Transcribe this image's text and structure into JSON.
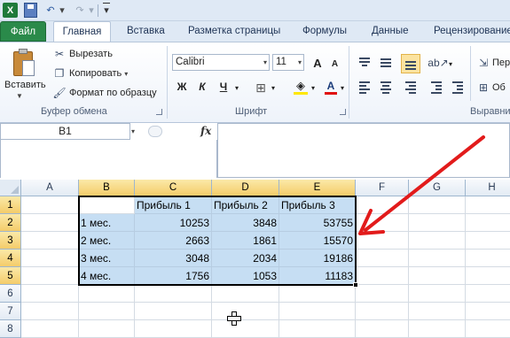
{
  "qat": {
    "logo": "X"
  },
  "tabs": [
    "Файл",
    "Главная",
    "Вставка",
    "Разметка страницы",
    "Формулы",
    "Данные",
    "Рецензирование"
  ],
  "clipboard": {
    "paste": "Вставить",
    "cut": "Вырезать",
    "copy": "Копировать",
    "format_painter": "Формат по образцу",
    "group": "Буфер обмена"
  },
  "font": {
    "name": "Calibri",
    "size": "11",
    "bold": "Ж",
    "italic": "К",
    "underline": "Ч",
    "group": "Шрифт"
  },
  "alignment": {
    "group": "Выравни"
  },
  "right_group": {
    "item1": "Пер",
    "item2": "Об"
  },
  "formula_bar": {
    "name_box": "B1",
    "fx": "fx"
  },
  "columns": [
    "A",
    "B",
    "C",
    "D",
    "E",
    "F",
    "G",
    "H"
  ],
  "rows": [
    "1",
    "2",
    "3",
    "4",
    "5",
    "6",
    "7",
    "8"
  ],
  "table": {
    "headers": [
      "",
      "Прибыль 1",
      "Прибыль 2",
      "Прибыль 3"
    ],
    "rows": [
      [
        "1 мес.",
        "10253",
        "3848",
        "53755"
      ],
      [
        "2 мес.",
        "2663",
        "1861",
        "15570"
      ],
      [
        "3 мес.",
        "3048",
        "2034",
        "19186"
      ],
      [
        "4 мес.",
        "1756",
        "1053",
        "11183"
      ]
    ]
  },
  "colors": {
    "accent_green": "#2a8a4a",
    "selection": "#c6def3",
    "arrow": "#e21b1b"
  }
}
